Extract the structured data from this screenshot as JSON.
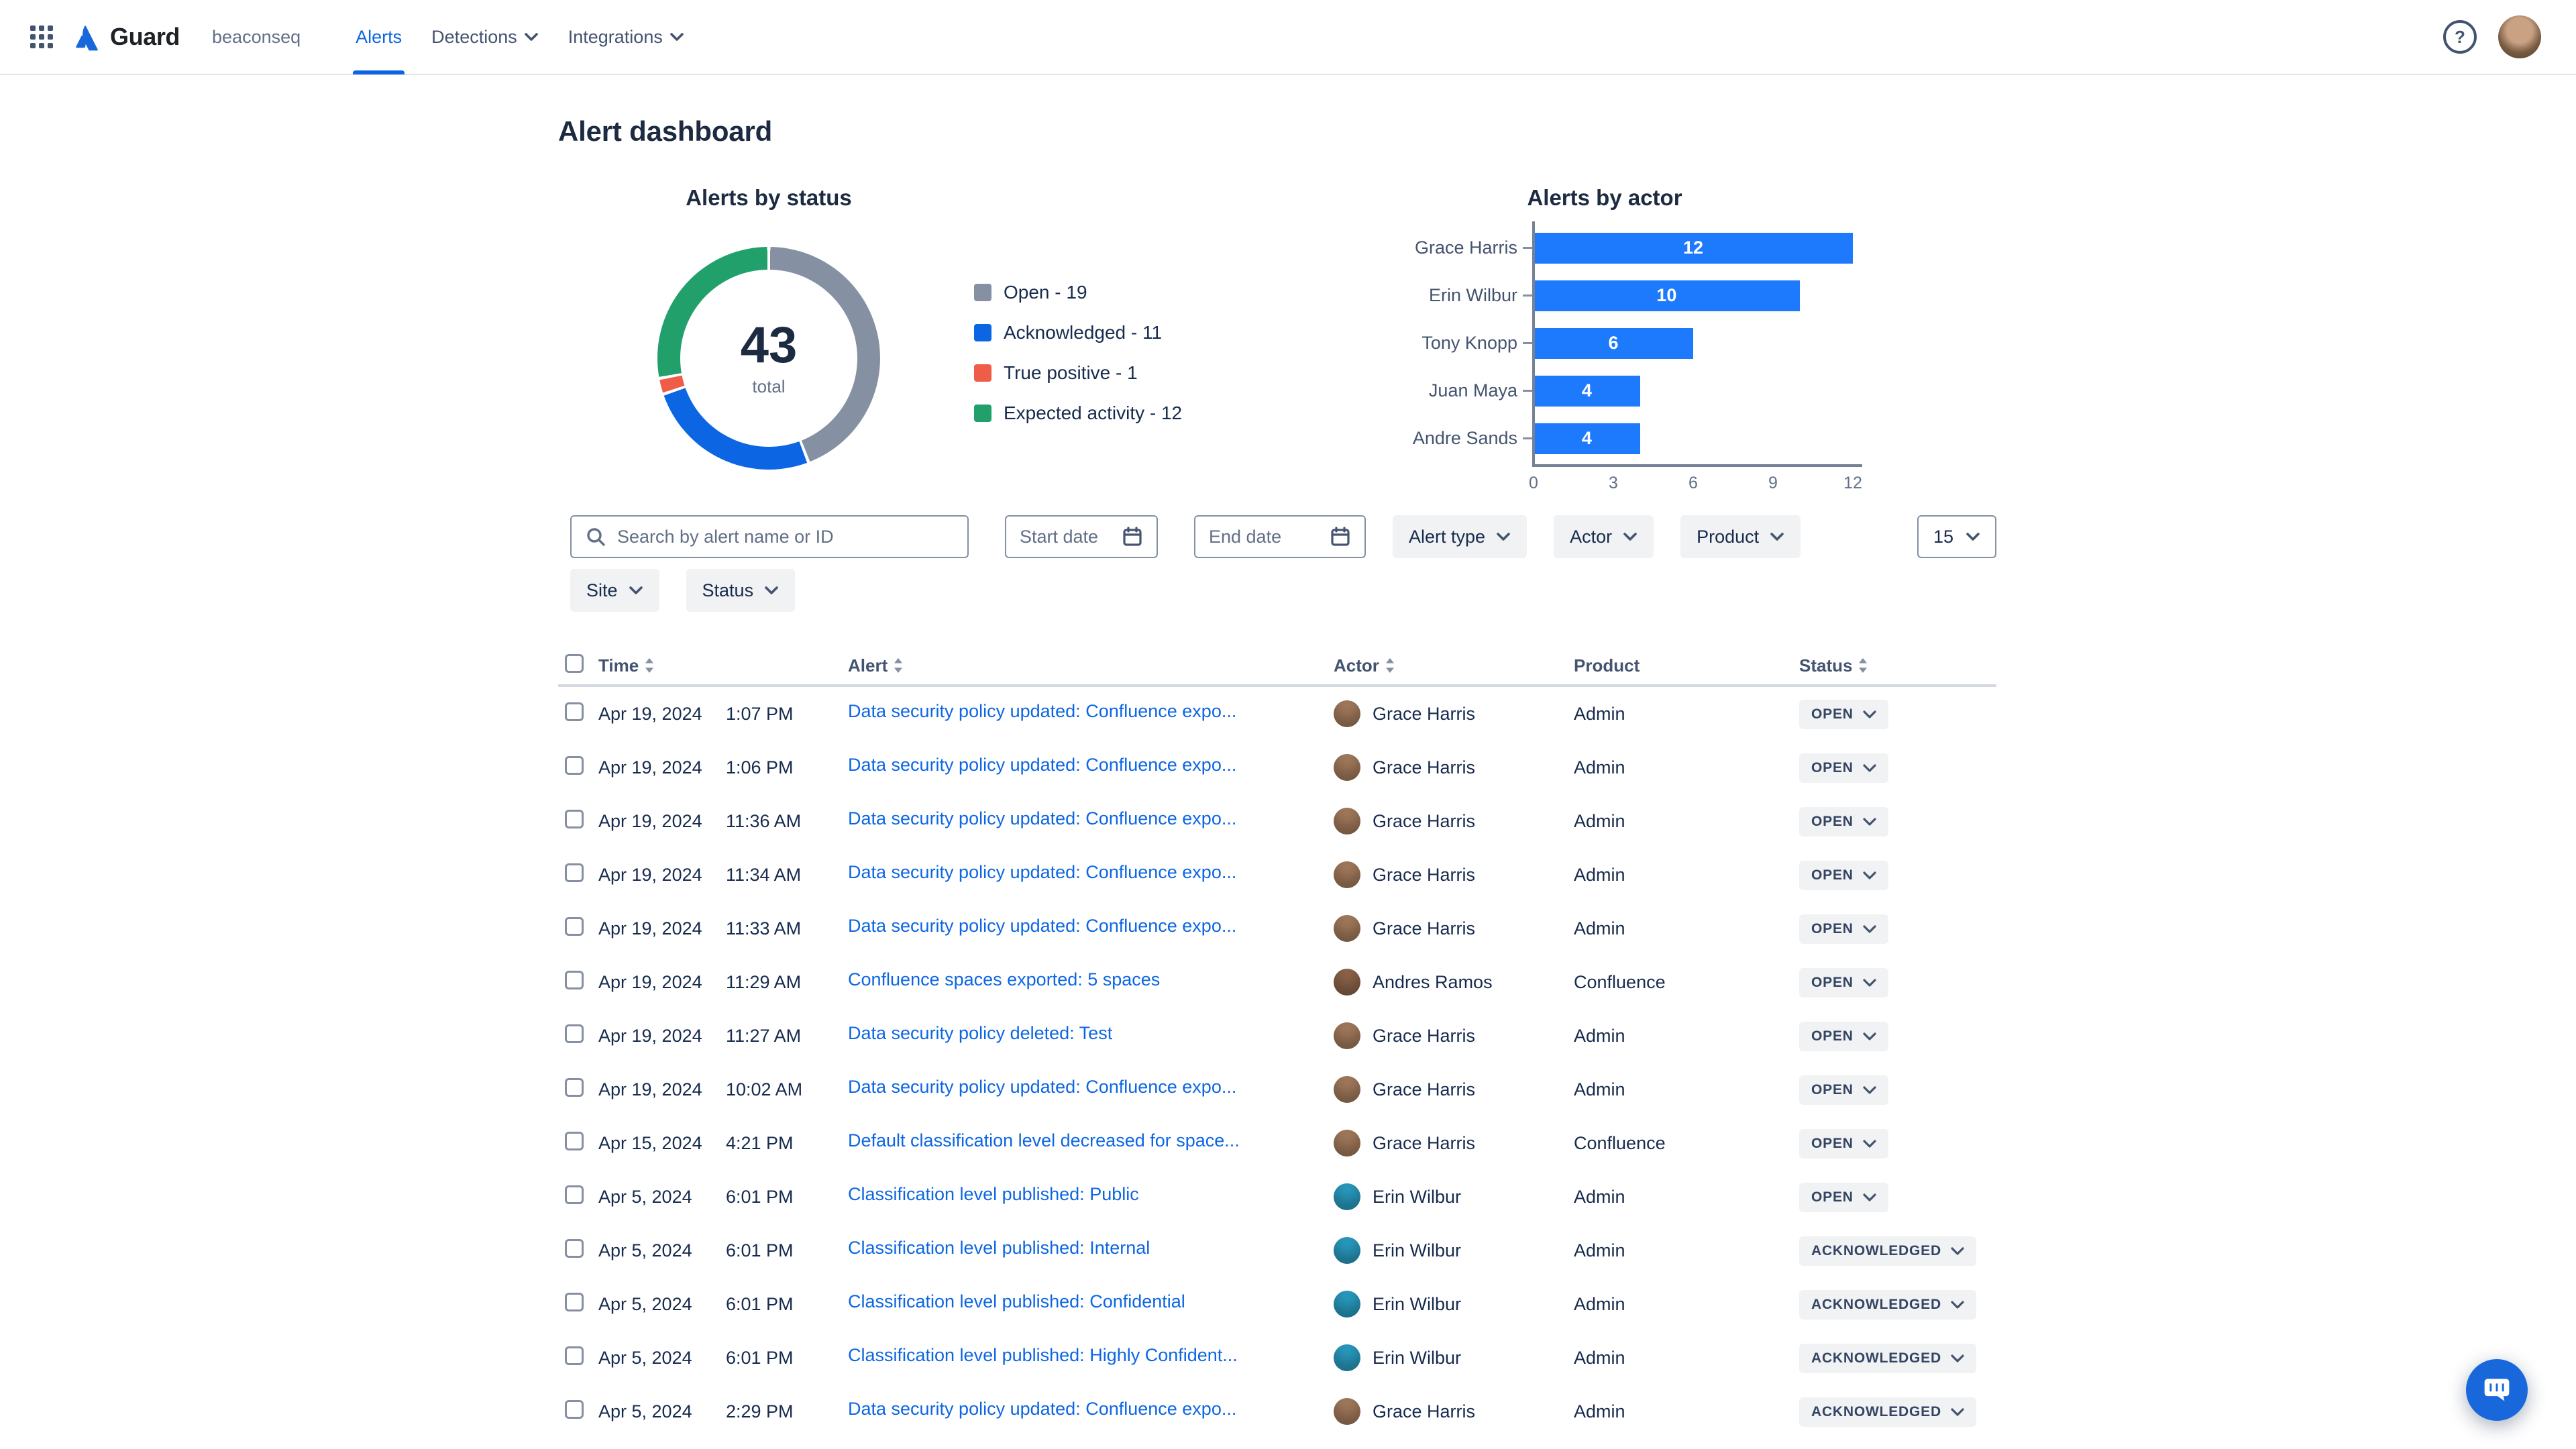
{
  "nav": {
    "app_name": "Guard",
    "org_name": "beaconseq",
    "tabs": [
      {
        "label": "Alerts",
        "active": true,
        "dropdown": false
      },
      {
        "label": "Detections",
        "active": false,
        "dropdown": true
      },
      {
        "label": "Integrations",
        "active": false,
        "dropdown": true
      }
    ]
  },
  "page": {
    "title": "Alert dashboard"
  },
  "chart_data": [
    {
      "type": "pie",
      "subtype": "donut",
      "title": "Alerts by status",
      "center_value": "43",
      "center_label": "total",
      "legend_separator": " - ",
      "legend_position": "right",
      "slices": [
        {
          "label": "Open",
          "value": 19,
          "color": "#8590A2"
        },
        {
          "label": "Acknowledged",
          "value": 11,
          "color": "#0C66E4"
        },
        {
          "label": "True positive",
          "value": 1,
          "color": "#EF5C48"
        },
        {
          "label": "Expected activity",
          "value": 12,
          "color": "#22A06B"
        }
      ]
    },
    {
      "type": "bar",
      "orientation": "horizontal",
      "title": "Alerts by actor",
      "categories": [
        "Grace Harris",
        "Erin Wilbur",
        "Tony Knopp",
        "Juan Maya",
        "Andre Sands"
      ],
      "values": [
        12,
        10,
        6,
        4,
        4
      ],
      "xlim": [
        0,
        12
      ],
      "xticks": [
        0,
        3,
        6,
        9,
        12
      ],
      "bar_color": "#1D7AFC",
      "value_label_color": "#FFFFFF",
      "grid": false
    }
  ],
  "filters": {
    "search_placeholder": "Search by alert name or ID",
    "start_date": "Start date",
    "end_date": "End date",
    "alert_type": "Alert type",
    "actor": "Actor",
    "product": "Product",
    "page_size": "15",
    "site": "Site",
    "status": "Status"
  },
  "table": {
    "columns": [
      {
        "label": "Time",
        "sortable": true
      },
      {
        "label": "Alert",
        "sortable": true
      },
      {
        "label": "Actor",
        "sortable": true
      },
      {
        "label": "Product",
        "sortable": false
      },
      {
        "label": "Status",
        "sortable": true
      }
    ],
    "avatar_colors": {
      "Grace Harris": "#A0785A",
      "Andres Ramos": "#8A6248",
      "Erin Wilbur": "#2898BD"
    },
    "rows": [
      {
        "date": "Apr 19, 2024",
        "time": "1:07 PM",
        "alert": "Data security policy updated: Confluence expo...",
        "actor": "Grace Harris",
        "product": "Admin",
        "status": "OPEN"
      },
      {
        "date": "Apr 19, 2024",
        "time": "1:06 PM",
        "alert": "Data security policy updated: Confluence expo...",
        "actor": "Grace Harris",
        "product": "Admin",
        "status": "OPEN"
      },
      {
        "date": "Apr 19, 2024",
        "time": "11:36 AM",
        "alert": "Data security policy updated: Confluence expo...",
        "actor": "Grace Harris",
        "product": "Admin",
        "status": "OPEN"
      },
      {
        "date": "Apr 19, 2024",
        "time": "11:34 AM",
        "alert": "Data security policy updated: Confluence expo...",
        "actor": "Grace Harris",
        "product": "Admin",
        "status": "OPEN"
      },
      {
        "date": "Apr 19, 2024",
        "time": "11:33 AM",
        "alert": "Data security policy updated: Confluence expo...",
        "actor": "Grace Harris",
        "product": "Admin",
        "status": "OPEN"
      },
      {
        "date": "Apr 19, 2024",
        "time": "11:29 AM",
        "alert": "Confluence spaces exported: 5 spaces",
        "actor": "Andres Ramos",
        "product": "Confluence",
        "status": "OPEN"
      },
      {
        "date": "Apr 19, 2024",
        "time": "11:27 AM",
        "alert": "Data security policy deleted: Test",
        "actor": "Grace Harris",
        "product": "Admin",
        "status": "OPEN"
      },
      {
        "date": "Apr 19, 2024",
        "time": "10:02 AM",
        "alert": "Data security policy updated: Confluence expo...",
        "actor": "Grace Harris",
        "product": "Admin",
        "status": "OPEN"
      },
      {
        "date": "Apr 15, 2024",
        "time": "4:21 PM",
        "alert": "Default classification level decreased for space...",
        "actor": "Grace Harris",
        "product": "Confluence",
        "status": "OPEN"
      },
      {
        "date": "Apr 5, 2024",
        "time": "6:01 PM",
        "alert": "Classification level published: Public",
        "actor": "Erin Wilbur",
        "product": "Admin",
        "status": "OPEN"
      },
      {
        "date": "Apr 5, 2024",
        "time": "6:01 PM",
        "alert": "Classification level published: Internal",
        "actor": "Erin Wilbur",
        "product": "Admin",
        "status": "ACKNOWLEDGED"
      },
      {
        "date": "Apr 5, 2024",
        "time": "6:01 PM",
        "alert": "Classification level published: Confidential",
        "actor": "Erin Wilbur",
        "product": "Admin",
        "status": "ACKNOWLEDGED"
      },
      {
        "date": "Apr 5, 2024",
        "time": "6:01 PM",
        "alert": "Classification level published: Highly Confident...",
        "actor": "Erin Wilbur",
        "product": "Admin",
        "status": "ACKNOWLEDGED"
      },
      {
        "date": "Apr 5, 2024",
        "time": "2:29 PM",
        "alert": "Data security policy updated: Confluence expo...",
        "actor": "Grace Harris",
        "product": "Admin",
        "status": "ACKNOWLEDGED"
      }
    ]
  },
  "colors": {
    "accent": "#0C66E4",
    "link": "#0C66E4",
    "chat_button": "#1868DB",
    "nav_active": "#0C66E4"
  }
}
